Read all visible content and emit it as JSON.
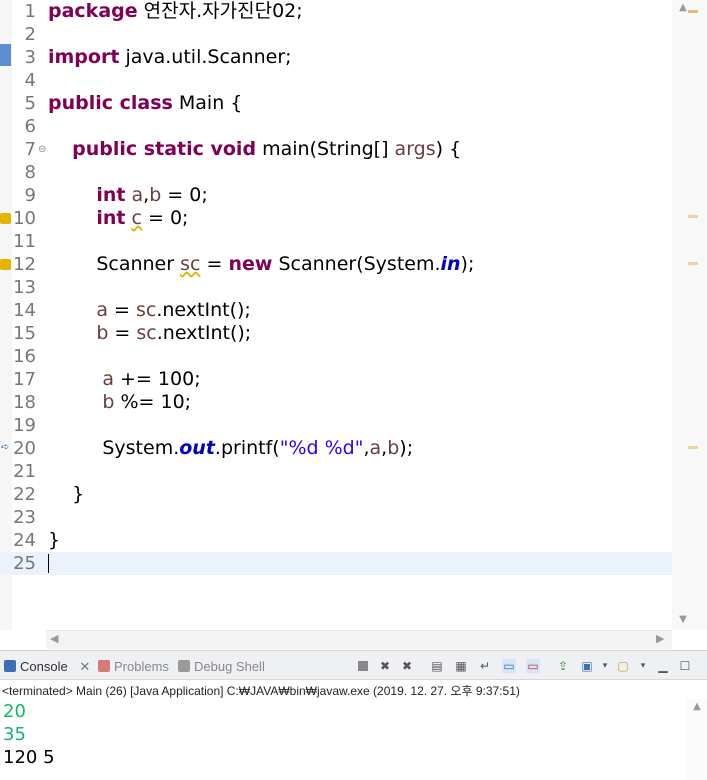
{
  "editor": {
    "lines": [
      {
        "n": "1",
        "html": "<span class=\"kw\">package</span> 연잔자.자가진단02;"
      },
      {
        "n": "2",
        "html": ""
      },
      {
        "n": "3",
        "html": "<span class=\"kw\">import</span> java.util.Scanner;"
      },
      {
        "n": "4",
        "html": ""
      },
      {
        "n": "5",
        "html": "<span class=\"kw\">public class</span> Main {"
      },
      {
        "n": "6",
        "html": ""
      },
      {
        "n": "7",
        "html": "    <span class=\"kw\">public static void</span> main(String[] <span class=\"var\">args</span>) {"
      },
      {
        "n": "8",
        "html": ""
      },
      {
        "n": "9",
        "html": "        <span class=\"kw\">int</span> <span class=\"var\">a</span>,<span class=\"var\">b</span> = 0;"
      },
      {
        "n": "10",
        "html": "        <span class=\"kw\">int</span> <span class=\"var warnline\">c</span> = 0;"
      },
      {
        "n": "11",
        "html": ""
      },
      {
        "n": "12",
        "html": "        Scanner <span class=\"var warnline\">sc</span> = <span class=\"kw\">new</span> Scanner(System.<span class=\"field\">in</span>);"
      },
      {
        "n": "13",
        "html": ""
      },
      {
        "n": "14",
        "html": "        <span class=\"var\">a</span> = <span class=\"var\">sc</span>.nextInt();"
      },
      {
        "n": "15",
        "html": "        <span class=\"var\">b</span> = <span class=\"var\">sc</span>.nextInt();"
      },
      {
        "n": "16",
        "html": ""
      },
      {
        "n": "17",
        "html": "         <span class=\"var\">a</span> += 100;"
      },
      {
        "n": "18",
        "html": "         <span class=\"var\">b</span> %= 10;"
      },
      {
        "n": "19",
        "html": ""
      },
      {
        "n": "20",
        "html": "         System.<span class=\"field\">out</span>.printf(<span class=\"str\">\"%d %d\"</span>,<span class=\"var\">a</span>,<span class=\"var\">b</span>);"
      },
      {
        "n": "21",
        "html": ""
      },
      {
        "n": "22",
        "html": "    }"
      },
      {
        "n": "23",
        "html": ""
      },
      {
        "n": "24",
        "html": "}"
      },
      {
        "n": "25",
        "html": ""
      }
    ]
  },
  "console": {
    "tabs": {
      "console": "Console",
      "problems": "Problems",
      "debug_shell": "Debug Shell"
    },
    "status": "<terminated> Main (26) [Java Application] C:₩JAVA₩bin₩javaw.exe (2019. 12. 27. 오후 9:37:51)",
    "output_input": [
      "20",
      "35"
    ],
    "output_result": "120 5"
  },
  "colors": {
    "keyword": "#7f0055",
    "variable": "#6a3e3e",
    "string": "#2a00ff",
    "field": "#0000c0",
    "highlight": "#c9e0b0",
    "console_input": "#18b473"
  },
  "icons": [
    "close-icon",
    "minimize-icon",
    "maximize-icon",
    "terminate-icon",
    "remove-launch-icon",
    "clear-console-icon",
    "pin-console-icon",
    "display-console-icon",
    "open-console-icon",
    "scroll-lock-icon",
    "word-wrap-icon",
    "warning-icon",
    "debug-arrow-icon"
  ]
}
